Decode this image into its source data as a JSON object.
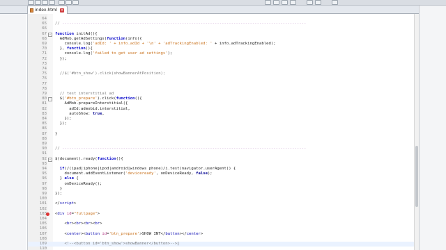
{
  "tab": {
    "label": "index.html"
  },
  "editor": {
    "lines": [
      {
        "n": "64",
        "html": ""
      },
      {
        "n": "65",
        "html": "<span class='cmt'>// </span><span class='dash'>--------------------------------------------------------------------------------------------------------</span>"
      },
      {
        "n": "66",
        "html": ""
      },
      {
        "n": "67",
        "html": "<span class='kw'>function</span> initAd(){",
        "fold": true
      },
      {
        "n": "68",
        "html": "  AdMob.getAdSettings(<span class='kw'>function</span>(info){"
      },
      {
        "n": "69",
        "html": "    console.log(<span class='str'>'adId: ' + info.adId + '\\n' + 'adTrackingEnabled: '</span> + info.adTrackingEnabled);"
      },
      {
        "n": "70",
        "html": "  }, <span class='kw'>function</span>(){"
      },
      {
        "n": "71",
        "html": "    console.log(<span class='str'>'failed to get user ad settings'</span>);"
      },
      {
        "n": "72",
        "html": "  });"
      },
      {
        "n": "73",
        "html": ""
      },
      {
        "n": "74",
        "html": ""
      },
      {
        "n": "75",
        "html": "  <span class='cmt'>//$('#btn_show').click(showBannerAtPosition);</span>"
      },
      {
        "n": "76",
        "html": ""
      },
      {
        "n": "77",
        "html": ""
      },
      {
        "n": "78",
        "html": ""
      },
      {
        "n": "79",
        "html": "  <span class='cmt'>// test interstitial ad</span>"
      },
      {
        "n": "80",
        "html": "  $(<span class='str'>'#btn_prepare'</span>).click(<span class='kw'>function</span>(){",
        "fold": true
      },
      {
        "n": "81",
        "html": "    AdMob.prepareInterstitial({"
      },
      {
        "n": "82",
        "html": "      adId:admobid.interstitial,"
      },
      {
        "n": "83",
        "html": "      autoShow: <span class='bool'>true</span>,"
      },
      {
        "n": "84",
        "html": "    });"
      },
      {
        "n": "85",
        "html": "  });"
      },
      {
        "n": "86",
        "html": ""
      },
      {
        "n": "87",
        "html": "}"
      },
      {
        "n": "88",
        "html": ""
      },
      {
        "n": "89",
        "html": ""
      },
      {
        "n": "90",
        "html": "<span class='cmt'>// </span><span class='dash'>--------------------------------------------------------------------------------------------------------</span>"
      },
      {
        "n": "91",
        "html": ""
      },
      {
        "n": "92",
        "html": "$(document).ready(<span class='kw'>function</span>(){",
        "fold": true
      },
      {
        "n": "93",
        "html": ""
      },
      {
        "n": "94",
        "html": "  <span class='kw'>if</span>(/(ipad|iphone|ipod|android|windows phone)/i.test(navigator.userAgent)) {"
      },
      {
        "n": "95",
        "html": "    document.addEventListener(<span class='str'>'deviceready'</span>, onDeviceReady, <span class='bool'>false</span>);"
      },
      {
        "n": "96",
        "html": "  } <span class='kw'>else</span> {"
      },
      {
        "n": "97",
        "html": "    onDeviceReady();"
      },
      {
        "n": "98",
        "html": "  }"
      },
      {
        "n": "99",
        "html": "});"
      },
      {
        "n": "100",
        "html": ""
      },
      {
        "n": "101",
        "html": "&lt;/<span class='tag'>script</span>&gt;"
      },
      {
        "n": "102",
        "html": ""
      },
      {
        "n": "103",
        "html": "&lt;<span class='tag'>div</span> <span class='attr'>id</span>=<span class='aval'>\"fullpage\"</span>&gt;",
        "error": true
      },
      {
        "n": "104",
        "html": ""
      },
      {
        "n": "105",
        "html": "    &lt;<span class='tag'>br</span>&gt;&lt;<span class='tag'>br</span>&gt;&lt;<span class='tag'>br</span>&gt;&lt;<span class='tag'>br</span>&gt;"
      },
      {
        "n": "106",
        "html": ""
      },
      {
        "n": "107",
        "html": "    &lt;<span class='tag'>center</span>&gt;&lt;<span class='tag'>button</span> <span class='attr'>id</span>=<span class='aval'>'btn_prepare'</span>&gt;SHOW INT&lt;/<span class='tag'>button</span>&gt;&lt;/<span class='tag'>center</span>&gt;"
      },
      {
        "n": "108",
        "html": ""
      },
      {
        "n": "109",
        "html": "    <span class='cmt'>&lt;!--&lt;button id='btn_show'&gt;showBanner&lt;/button&gt;--&gt;</span>|",
        "current": true
      },
      {
        "n": "110",
        "html": ""
      }
    ]
  }
}
